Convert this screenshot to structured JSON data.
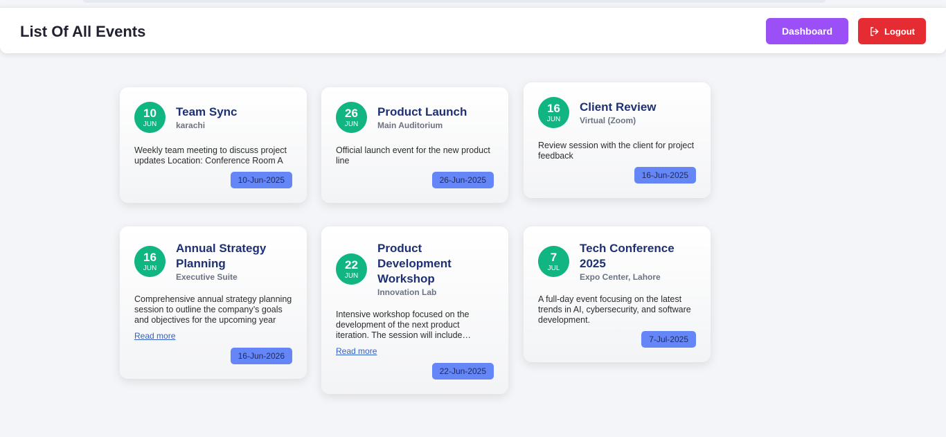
{
  "header": {
    "title": "List Of All Events",
    "dashboard_label": "Dashboard",
    "logout_label": "Logout"
  },
  "events": [
    {
      "day": "10",
      "month": "JUN",
      "title": "Team Sync",
      "location": "karachi",
      "description": "Weekly team meeting to discuss project updates Location: Conference Room A",
      "date": "10-Jun-2025"
    },
    {
      "day": "26",
      "month": "JUN",
      "title": "Product Launch",
      "location": "Main Auditorium",
      "description": "Official launch event for the new product line",
      "date": "26-Jun-2025"
    },
    {
      "day": "16",
      "month": "JUN",
      "title": "Client Review",
      "location": "Virtual (Zoom)",
      "description": "Review session with the client for project feedback",
      "date": "16-Jun-2025"
    },
    {
      "day": "16",
      "month": "JUN",
      "title": "Annual Strategy Planning",
      "location": "Executive Suite",
      "description": "Comprehensive annual strategy planning session to outline the company’s goals and objectives for the upcoming year",
      "read_more": "Read more",
      "date": "16-Jun-2026"
    },
    {
      "day": "22",
      "month": "JUN",
      "title": "Product Development Workshop",
      "location": "Innovation Lab",
      "description": "Intensive workshop focused on the development of the next product iteration. The session will include brainstorming and prototyping",
      "read_more": "Read more",
      "date": "22-Jun-2025"
    },
    {
      "day": "7",
      "month": "JUL",
      "title": "Tech Conference 2025",
      "location": "Expo Center, Lahore",
      "description": "A full-day event focusing on the latest trends in AI, cybersecurity, and software development.",
      "date": "7-Jul-2025"
    }
  ]
}
